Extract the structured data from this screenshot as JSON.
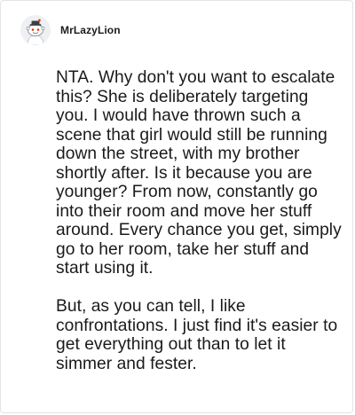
{
  "post": {
    "username": "MrLazyLion",
    "avatar_icon": "reddit-snoo-avatar-icon",
    "paragraphs": [
      "NTA. Why don't you want to escalate this? She is deliberately targeting you. I would have thrown such a scene that girl would still be running down the street, with my brother shortly after. Is it because you are younger? From now, constantly go into their room and move her stuff around. Every chance you get, simply go to her room, take her stuff and start using it.",
      "But, as you can tell, I like confrontations. I just find it's easier to get everything out than to let it simmer and fester."
    ]
  },
  "colors": {
    "text": "#1a1a1a",
    "avatar_bg": "#eef0f3",
    "avatar_accent": "#d93a00"
  }
}
